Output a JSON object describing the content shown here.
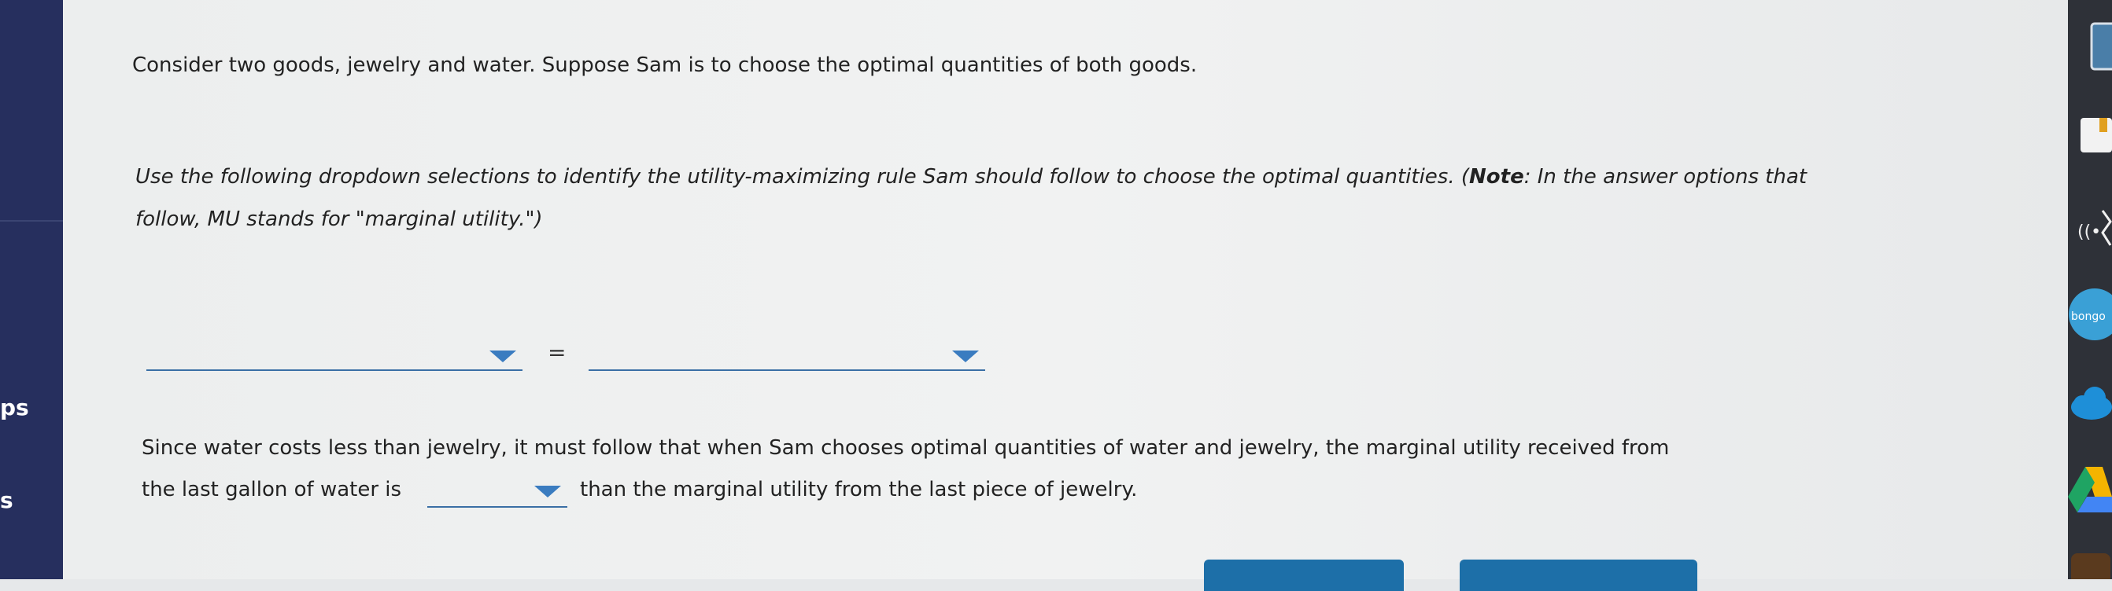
{
  "sidebar": {
    "labels": [
      "ps",
      "s"
    ]
  },
  "intro_text": "Consider two goods, jewelry and water. Suppose Sam is to choose the optimal quantities of both goods.",
  "instructions": {
    "before_note": "Use the following dropdown selections to identify the utility-maximizing rule Sam should follow to choose the optimal quantities. (",
    "note_label": "Note",
    "after_note": ": In the answer options that follow, MU stands for \"marginal utility.\")"
  },
  "rule": {
    "left_dropdown_value": "",
    "equals": "=",
    "right_dropdown_value": ""
  },
  "comparison": {
    "line1": "Since water costs less than jewelry, it must follow that when Sam chooses optimal quantities of water and jewelry, the marginal utility received from",
    "line2_before": "the last gallon of water is",
    "dropdown_value": "",
    "line2_after": "than the marginal utility from the last piece of jewelry."
  },
  "dock": {
    "icons": [
      "document-icon",
      "bookmark-icon",
      "broadcast-icon",
      "bongo-icon",
      "cloud-icon",
      "google-drive-icon",
      "app-icon"
    ],
    "bongo_label": "bongo"
  },
  "colors": {
    "sidebar": "#262f5e",
    "link_blue": "#3a7cc0",
    "button_blue": "#1d6fa8"
  }
}
